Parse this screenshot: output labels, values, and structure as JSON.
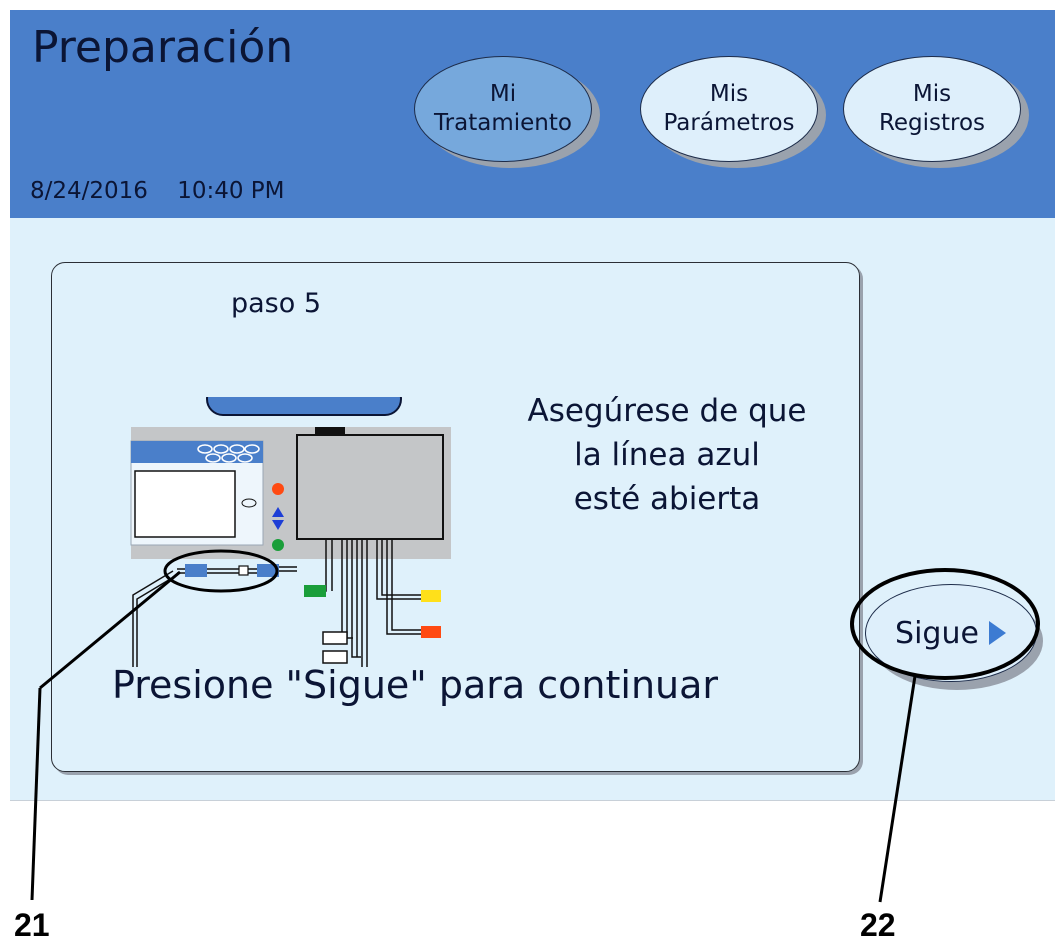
{
  "header": {
    "title": "Preparación",
    "date": "8/24/2016",
    "time": "10:40 PM"
  },
  "tabs": [
    {
      "line1": "Mi",
      "line2": "Tratamiento",
      "active": true
    },
    {
      "line1": "Mis",
      "line2": "Parámetros",
      "active": false
    },
    {
      "line1": "Mis",
      "line2": "Registros",
      "active": false
    }
  ],
  "step": {
    "label": "paso 5",
    "instruction_lines": [
      "Asegúrese de que",
      "la línea azul",
      "esté abierta"
    ],
    "continue_text": "Presione \"Sigue\" para continuar"
  },
  "sigue_button": {
    "label": "Sigue",
    "icon": "play-arrow-icon"
  },
  "callouts": {
    "line_callout": "21",
    "button_callout": "22"
  },
  "colors": {
    "header": "#4a7fca",
    "content": "#dff1fb",
    "active_tab": "#76a8dc",
    "button": "#deeffb",
    "arrow": "#3c7bd2",
    "blue_line": "#4a7fca"
  }
}
